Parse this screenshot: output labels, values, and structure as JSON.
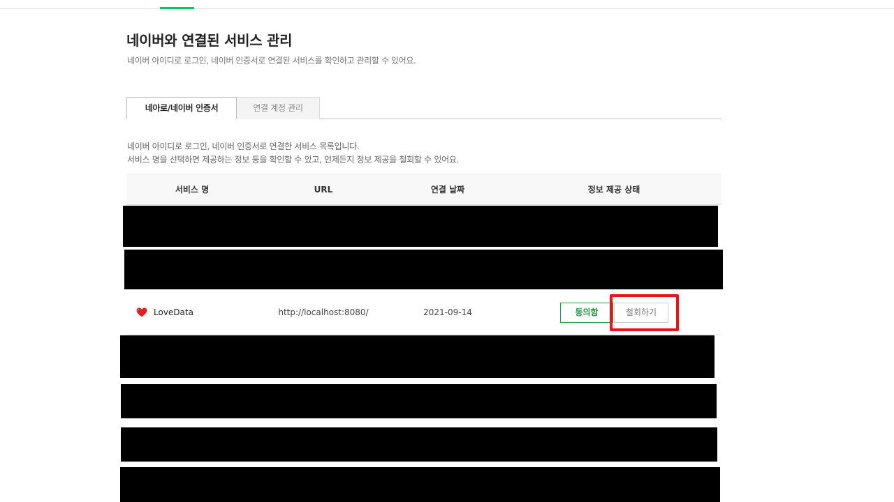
{
  "header": {
    "title": "네이버와 연결된 서비스 관리",
    "description": "네이버 아이디로 로그인, 네이버 인증서로 연결된 서비스를 확인하고 관리할 수 있어요."
  },
  "tabs": [
    {
      "label": "네아로/네이버 인증서",
      "active": true
    },
    {
      "label": "연결 계정 관리",
      "active": false
    }
  ],
  "list": {
    "description_line1": "네이버 아이디로 로그인, 네이버 인증서로 연결한 서비스 목록입니다.",
    "description_line2": "서비스 명을 선택하면 제공하는 정보 등을 확인할 수 있고, 언제든지 정보 제공을 철회할 수 있어요."
  },
  "table": {
    "columns": [
      "서비스 명",
      "URL",
      "연결 날짜",
      "정보 제공 상태"
    ],
    "rows": [
      {
        "icon": "heart-icon",
        "service_name": "LoveData",
        "url": "http://localhost:8080/",
        "date": "2021-09-14",
        "status_label": "동의함",
        "revoke_label": "철회하기"
      }
    ]
  },
  "colors": {
    "accent": "#03c75a",
    "agree": "#1e9a3c",
    "highlight": "#e8141b",
    "heart": "#e02020"
  }
}
